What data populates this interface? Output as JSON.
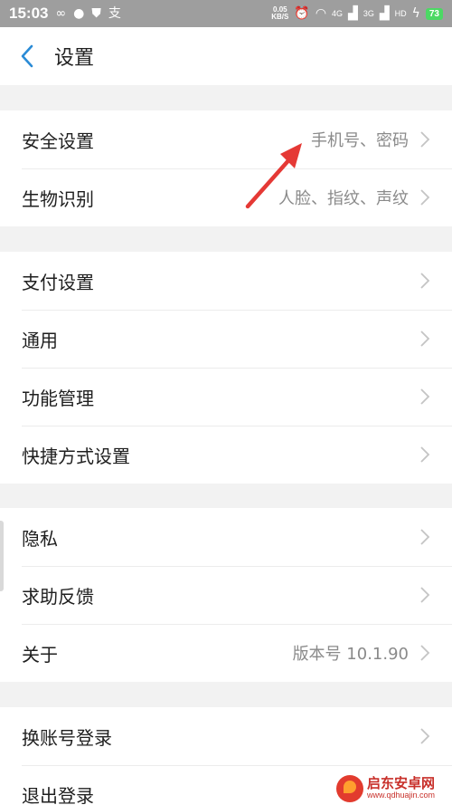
{
  "status_bar": {
    "time": "15:03",
    "speed_value": "0.05",
    "speed_unit": "KB/S",
    "network_1": "4G",
    "network_2": "3G",
    "hd": "HD",
    "battery": "73"
  },
  "header": {
    "title": "设置"
  },
  "groups": [
    [
      {
        "label": "安全设置",
        "value": "手机号、密码"
      },
      {
        "label": "生物识别",
        "value": "人脸、指纹、声纹"
      }
    ],
    [
      {
        "label": "支付设置",
        "value": ""
      },
      {
        "label": "通用",
        "value": ""
      },
      {
        "label": "功能管理",
        "value": ""
      },
      {
        "label": "快捷方式设置",
        "value": ""
      }
    ],
    [
      {
        "label": "隐私",
        "value": ""
      },
      {
        "label": "求助反馈",
        "value": ""
      },
      {
        "label": "关于",
        "value": "版本号 10.1.90"
      }
    ],
    [
      {
        "label": "换账号登录",
        "value": ""
      },
      {
        "label": "退出登录",
        "value": ""
      }
    ]
  ],
  "watermark": {
    "title": "启东安卓网",
    "url": "www.qdhuajin.com"
  },
  "colors": {
    "accent": "#2a8bd6",
    "annotation_arrow": "#e53935",
    "status_bar_bg": "#9e9e9e"
  }
}
